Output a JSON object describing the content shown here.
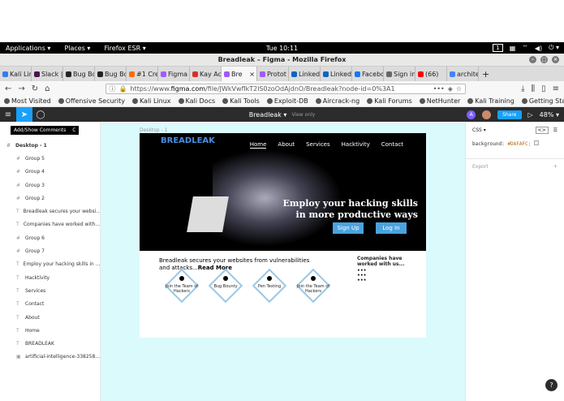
{
  "gnome": {
    "applications": "Applications ▾",
    "places": "Places ▾",
    "firefox": "Firefox ESR ▾",
    "clock": "Tue 10:11",
    "workspace": "1"
  },
  "window": {
    "title": "Breadleak – Figma - Mozilla Firefox"
  },
  "tabs": [
    {
      "label": "Kali Linux",
      "color": "#367bf0"
    },
    {
      "label": "Slack |",
      "color": "#4a154b"
    },
    {
      "label": "Bug Bo",
      "color": "#222222"
    },
    {
      "label": "Bug Bo",
      "color": "#222222"
    },
    {
      "label": "#1 Cre",
      "color": "#ff6b00"
    },
    {
      "label": "Figma",
      "color": "#a259ff"
    },
    {
      "label": "Kay Ac",
      "color": "#d93025"
    },
    {
      "label": "Bre",
      "color": "#a259ff",
      "active": true
    },
    {
      "label": "Protot",
      "color": "#a259ff"
    },
    {
      "label": "Linked",
      "color": "#0a66c2"
    },
    {
      "label": "Linked",
      "color": "#0a66c2"
    },
    {
      "label": "Facebo",
      "color": "#1877f2"
    },
    {
      "label": "Sign in",
      "color": "#666666"
    },
    {
      "label": "(66)",
      "color": "#ff0000"
    },
    {
      "label": "archite",
      "color": "#4285f4"
    }
  ],
  "url": {
    "prefix": "https://www.",
    "domain": "figma.com",
    "path": "/file/JWkVwflkT2lS0zoOdAjdnO/Breadleak?node-id=0%3A1"
  },
  "bookmarks": [
    "Most Visited",
    "Offensive Security",
    "Kali Linux",
    "Kali Docs",
    "Kali Tools",
    "Exploit-DB",
    "Aircrack-ng",
    "Kali Forums",
    "NetHunter",
    "Kali Training",
    "Getting Started"
  ],
  "figma": {
    "file_name": "Breadleak ▾",
    "view_only": "View only",
    "share": "Share",
    "zoom": "48% ▾",
    "avatar_letter": "A"
  },
  "tooltip": {
    "label": "Add/Show Comments",
    "shortcut": "C"
  },
  "layers": {
    "frame": "Desktop - 1",
    "items": [
      {
        "icon": "#",
        "label": "Group 5"
      },
      {
        "icon": "#",
        "label": "Group 4"
      },
      {
        "icon": "#",
        "label": "Group 3"
      },
      {
        "icon": "#",
        "label": "Group 2"
      },
      {
        "icon": "T",
        "label": "Breadleak secures your websi..."
      },
      {
        "icon": "T",
        "label": "Companies have worked with..."
      },
      {
        "icon": "#",
        "label": "Group 6"
      },
      {
        "icon": "#",
        "label": "Group 7"
      },
      {
        "icon": "T",
        "label": "Employ your hacking skills in ..."
      },
      {
        "icon": "T",
        "label": "Hacktivity"
      },
      {
        "icon": "T",
        "label": "Services"
      },
      {
        "icon": "T",
        "label": "Contact"
      },
      {
        "icon": "T",
        "label": "About"
      },
      {
        "icon": "T",
        "label": "Home"
      },
      {
        "icon": "T",
        "label": "BREADLEAK"
      },
      {
        "icon": "▣",
        "label": "artificial-intelligence-338258..."
      }
    ]
  },
  "canvas": {
    "frame_label": "Desktop - 1",
    "brand": "BREADLEAK",
    "menu": [
      "Home",
      "About",
      "Services",
      "Hacktivity",
      "Contact"
    ],
    "headline_1": "Employ your hacking skills",
    "headline_2": "in more productive ways",
    "signup": "Sign Up",
    "login": "Log In",
    "about_text": "Breadleak secures your websites from vulnerabilities and attacks...",
    "read_more": "Read More",
    "companies": "Companies have worked with us...",
    "dots": [
      "•••",
      "•••",
      "•••"
    ],
    "diamonds": [
      "Join the Team of Hackers",
      "Bug Bounty",
      "Pen Testing",
      "Join the Team of Hackers"
    ]
  },
  "props": {
    "tab_css": "CSS ▾",
    "code_key": "background:",
    "code_val": "#DAFAFC;",
    "export": "Export",
    "swatch_color": "#DAFAFC",
    "canvas_bg": "#DAFAFC"
  }
}
